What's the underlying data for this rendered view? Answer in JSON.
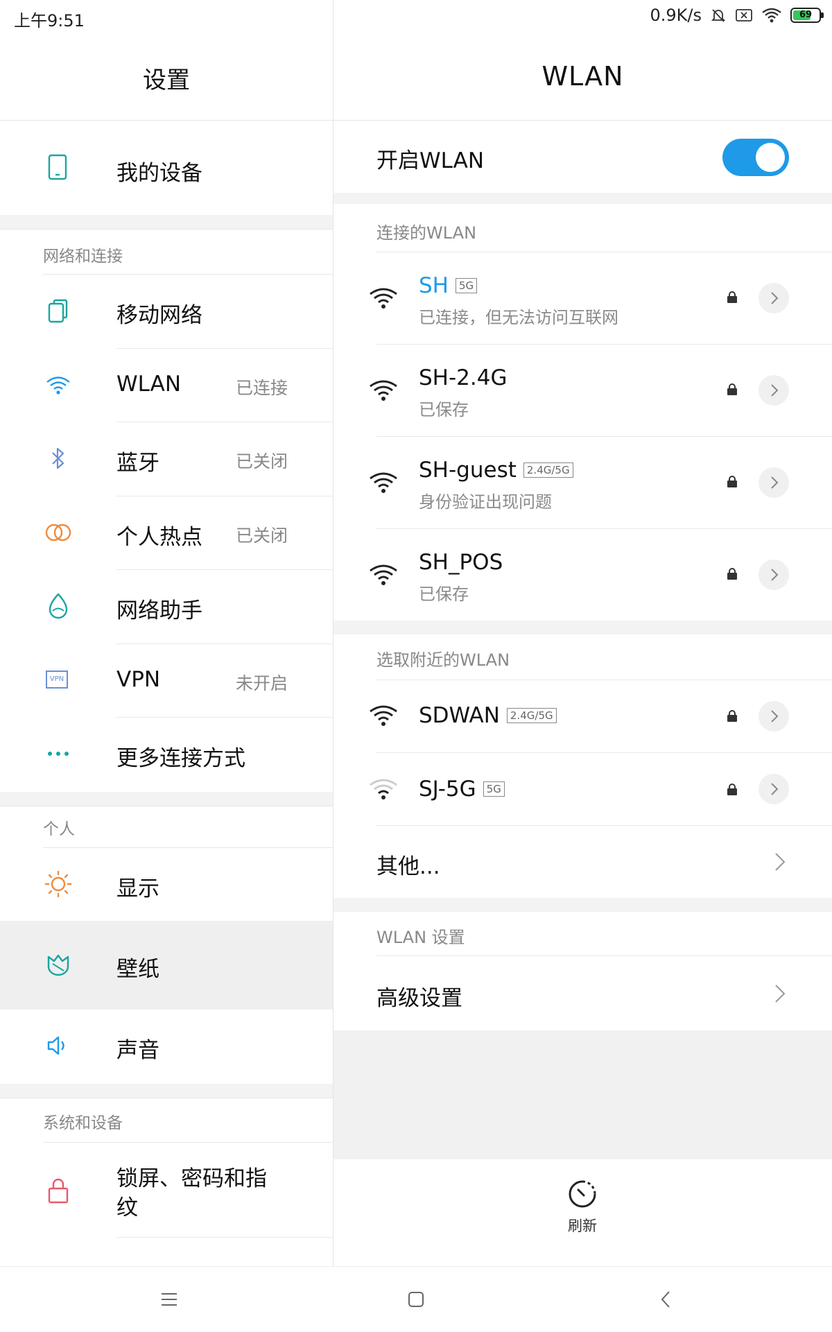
{
  "status_bar": {
    "time": "上午9:51",
    "speed": "0.9K/s",
    "battery": "69",
    "battery_level": 0.69
  },
  "left_pane": {
    "title": "设置",
    "my_device": "我的设备",
    "section_network": "网络和连接",
    "items_network": [
      {
        "label": "移动网络",
        "status": "",
        "icon": "mobile-network-icon"
      },
      {
        "label": "WLAN",
        "status": "已连接",
        "icon": "wifi-icon"
      },
      {
        "label": "蓝牙",
        "status": "已关闭",
        "icon": "bluetooth-icon"
      },
      {
        "label": "个人热点",
        "status": "已关闭",
        "icon": "hotspot-icon"
      },
      {
        "label": "网络助手",
        "status": "",
        "icon": "network-assistant-icon"
      },
      {
        "label": "VPN",
        "status": "未开启",
        "icon": "vpn-icon"
      },
      {
        "label": "更多连接方式",
        "status": "",
        "icon": "more-dots-icon"
      }
    ],
    "section_personal": "个人",
    "items_personal": [
      {
        "label": "显示",
        "icon": "display-sun-icon"
      },
      {
        "label": "壁纸",
        "icon": "wallpaper-icon"
      },
      {
        "label": "声音",
        "icon": "sound-icon"
      }
    ],
    "section_system": "系统和设备",
    "lock_item_line1": "锁屏、密码和指",
    "lock_item_line2": "纹",
    "vpn_icon_text": "VPN"
  },
  "right_pane": {
    "title": "WLAN",
    "toggle_label": "开启WLAN",
    "toggle_on": true,
    "section_connected": "连接的WLAN",
    "saved_networks": [
      {
        "name": "SH",
        "band": "5G",
        "status": "已连接，但无法访问互联网",
        "connected": true
      },
      {
        "name": "SH-2.4G",
        "band": "",
        "status": "已保存",
        "connected": false
      },
      {
        "name": "SH-guest",
        "band": "2.4G/5G",
        "status": "身份验证出现问题",
        "connected": false
      },
      {
        "name": "SH_POS",
        "band": "",
        "status": "已保存",
        "connected": false
      }
    ],
    "section_nearby": "选取附近的WLAN",
    "nearby_networks": [
      {
        "name": "SDWAN",
        "band": "2.4G/5G"
      },
      {
        "name": "SJ-5G",
        "band": "5G"
      }
    ],
    "other": "其他...",
    "section_settings": "WLAN 设置",
    "advanced": "高级设置",
    "refresh": "刷新"
  },
  "colors": {
    "accent": "#1e9ae8",
    "teal_icon": "#19a5a0",
    "orange_icon": "#f08a3c",
    "red_icon": "#e8596a"
  }
}
